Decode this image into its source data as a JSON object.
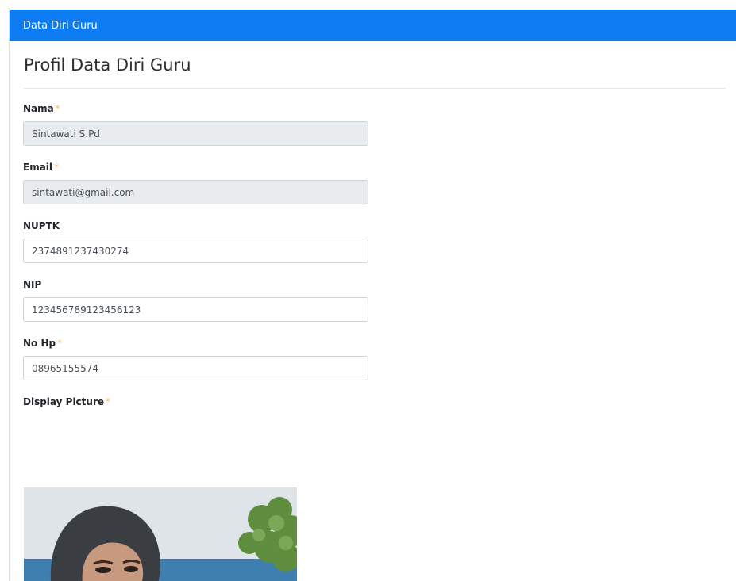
{
  "header": {
    "title": "Data Diri Guru"
  },
  "page": {
    "title": "Profil Data Diri Guru"
  },
  "required_mark": "*",
  "form": {
    "nama": {
      "label": "Nama",
      "value": "Sintawati S.Pd"
    },
    "email": {
      "label": "Email",
      "value": "sintawati@gmail.com"
    },
    "nuptk": {
      "label": "NUPTK",
      "value": "2374891237430274"
    },
    "nip": {
      "label": "NIP",
      "value": "123456789123456123"
    },
    "no_hp": {
      "label": "No Hp",
      "value": "08965155574"
    },
    "display_picture": {
      "label": "Display Picture"
    }
  },
  "colors": {
    "header_bg": "#0d7cf2",
    "required": "#f5c36b",
    "readonly_bg": "#e9ecef"
  }
}
